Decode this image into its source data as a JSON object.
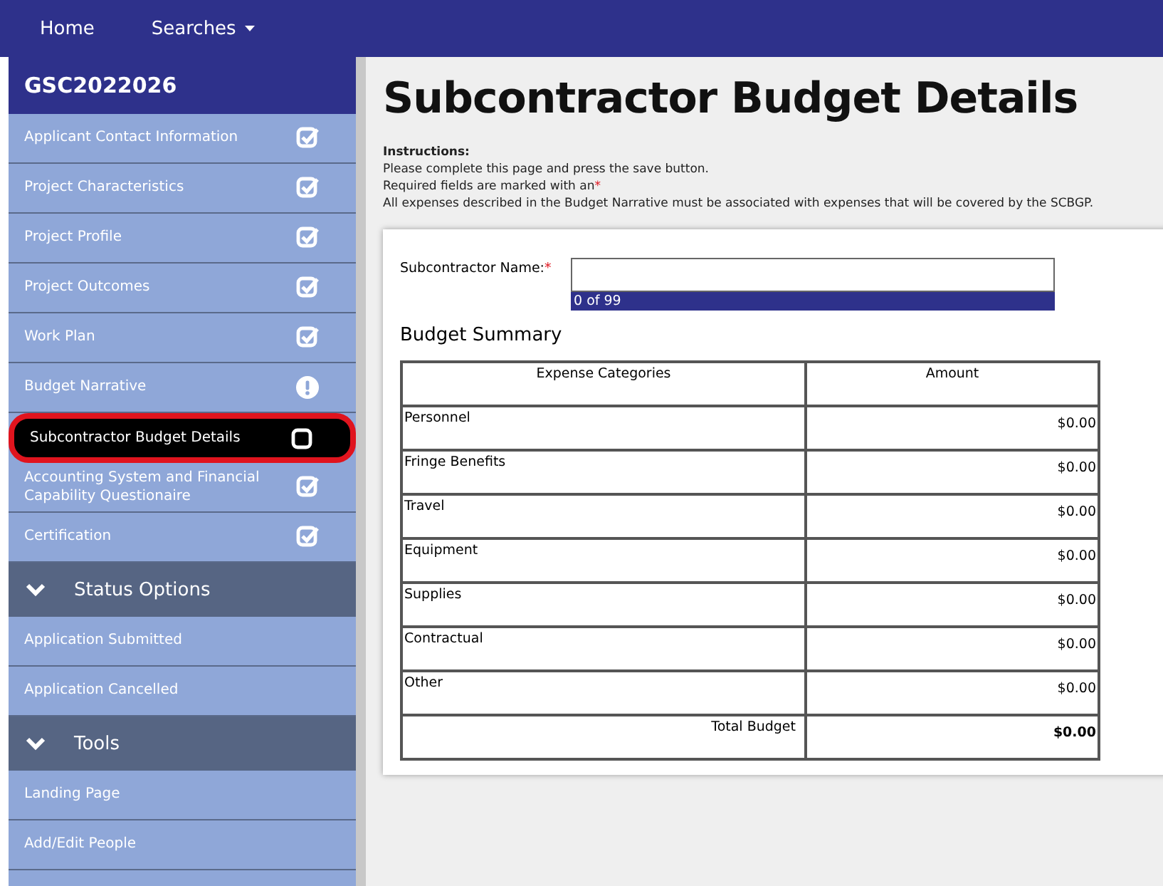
{
  "nav": {
    "items": [
      {
        "label": "Home",
        "dropdown": false
      },
      {
        "label": "Searches",
        "dropdown": true
      }
    ]
  },
  "sidebar": {
    "title": "GSC2022026",
    "items": [
      {
        "label": "Applicant Contact Information",
        "kind": "complete",
        "selected": false
      },
      {
        "label": "Project Characteristics",
        "kind": "complete",
        "selected": false
      },
      {
        "label": "Project Profile",
        "kind": "complete",
        "selected": false
      },
      {
        "label": "Project Outcomes",
        "kind": "complete",
        "selected": false
      },
      {
        "label": "Work Plan",
        "kind": "complete",
        "selected": false
      },
      {
        "label": "Budget Narrative",
        "kind": "alert",
        "selected": false
      },
      {
        "label": "Subcontractor Budget Details",
        "kind": "incomplete",
        "selected": true
      },
      {
        "label": "Accounting System and Financial Capability Questionaire",
        "kind": "complete",
        "selected": false
      },
      {
        "label": "Certification",
        "kind": "complete",
        "selected": false
      }
    ],
    "sections": [
      {
        "title": "Status Options",
        "expanded": true,
        "items": [
          {
            "label": "Application Submitted"
          },
          {
            "label": "Application Cancelled"
          }
        ]
      },
      {
        "title": "Tools",
        "expanded": true,
        "items": [
          {
            "label": "Landing Page"
          },
          {
            "label": "Add/Edit People"
          }
        ]
      }
    ]
  },
  "page": {
    "title": "Subcontractor Budget Details",
    "instructions_heading": "Instructions:",
    "instructions": [
      "Please complete this page and press the save button.",
      "Required fields are marked with an",
      "All expenses described in the Budget Narrative must be associated with expenses that will be covered by the SCBGP."
    ],
    "required_mark": "*",
    "form": {
      "label": "Subcontractor Name:",
      "required": true,
      "counter": "0 of 99"
    },
    "summary_title": "Budget Summary",
    "table": {
      "columns": [
        "Expense Categories",
        "Amount"
      ],
      "rows": [
        {
          "category": "Personnel",
          "amount": "$0.00"
        },
        {
          "category": "Fringe Benefits",
          "amount": "$0.00"
        },
        {
          "category": "Travel",
          "amount": "$0.00"
        },
        {
          "category": "Equipment",
          "amount": "$0.00"
        },
        {
          "category": "Supplies",
          "amount": "$0.00"
        },
        {
          "category": "Contractual",
          "amount": "$0.00"
        },
        {
          "category": "Other",
          "amount": "$0.00"
        }
      ],
      "total": {
        "label": "Total Budget",
        "amount": "$0.00"
      }
    }
  }
}
